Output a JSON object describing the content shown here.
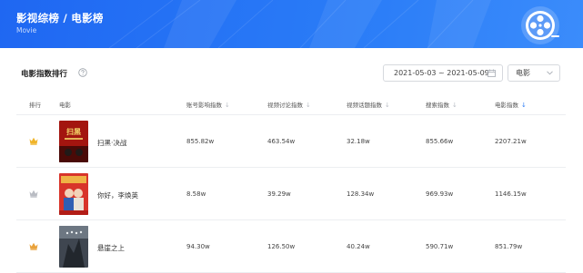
{
  "header": {
    "title": "影视综榜 / 电影榜",
    "subtitle": "Movie"
  },
  "section": {
    "title": "电影指数排行"
  },
  "filters": {
    "date_range": "2021-05-03 ~ 2021-05-09",
    "category": "电影"
  },
  "columns": {
    "rank": "排行",
    "movie": "电影",
    "account_influence": "账号影响指数",
    "video_discussion": "视频讨论指数",
    "video_topic": "视频话题指数",
    "search": "搜索指数",
    "movie_index": "电影指数"
  },
  "sort_arrow": "↓",
  "rows": [
    {
      "title": "扫黑·决战",
      "account_influence": "855.82w",
      "video_discussion": "463.54w",
      "video_topic": "32.18w",
      "search": "855.66w",
      "movie_index": "2207.21w",
      "crown_color": "#f0b428",
      "poster_text": "扫黑"
    },
    {
      "title": "你好，李焕英",
      "account_influence": "8.58w",
      "video_discussion": "39.29w",
      "video_topic": "128.34w",
      "search": "969.93w",
      "movie_index": "1146.15w",
      "crown_color": "#b9bcc3"
    },
    {
      "title": "悬崖之上",
      "account_influence": "94.30w",
      "video_discussion": "126.50w",
      "video_topic": "40.24w",
      "search": "590.71w",
      "movie_index": "851.79w",
      "crown_color": "#e9a23b"
    }
  ],
  "colors": {
    "brand": "#1f67f2",
    "accent": "#2b7bf6"
  }
}
